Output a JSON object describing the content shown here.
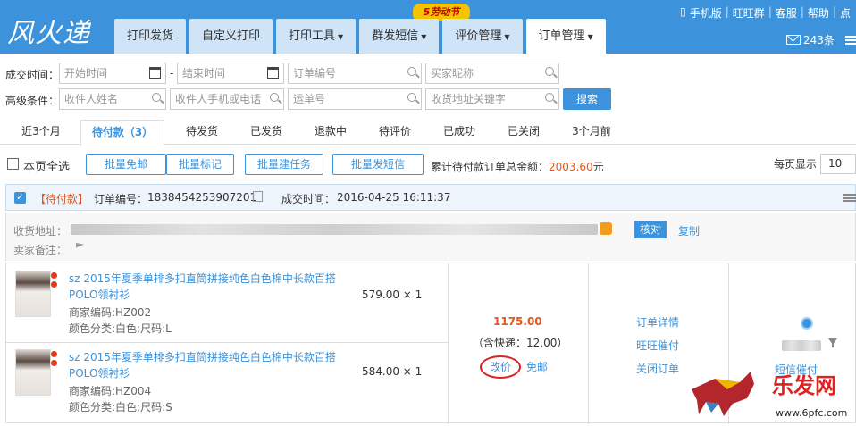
{
  "header": {
    "logo": "风火递",
    "nav": [
      {
        "label": "打印发货",
        "caret": false,
        "active": false
      },
      {
        "label": "自定义打印",
        "caret": false,
        "active": false
      },
      {
        "label": "打印工具",
        "caret": true,
        "active": false
      },
      {
        "label": "群发短信",
        "caret": true,
        "active": false
      },
      {
        "label": "评价管理",
        "caret": true,
        "active": false
      },
      {
        "label": "订单管理",
        "caret": true,
        "active": true
      }
    ],
    "promo": "5劳动节",
    "toplinks": [
      "手机版",
      "旺旺群",
      "客服",
      "帮助",
      "点"
    ],
    "mail_count": "243条"
  },
  "filters": {
    "row1_label": "成交时间：",
    "start_ph": "开始时间",
    "dash": "-",
    "end_ph": "结束时间",
    "order_no_ph": "订单编号",
    "buyer_ph": "买家昵称",
    "row2_label": "高级条件：",
    "receiver_name_ph": "收件人姓名",
    "receiver_phone_ph": "收件人手机或电话",
    "waybill_ph": "运单号",
    "address_ph": "收货地址关键字",
    "search": "搜索"
  },
  "tabs": [
    "近3个月",
    "待付款（3）",
    "待发货",
    "已发货",
    "退款中",
    "待评价",
    "已成功",
    "已关闭",
    "3个月前"
  ],
  "active_tab": 1,
  "toolbar": {
    "select_all": "本页全选",
    "buttons": [
      "批量免邮",
      "批量标记",
      "批量建任务",
      "批量发短信"
    ],
    "total_label": "累计待付款订单总金额：",
    "total_amount": "2003.60",
    "total_unit": "元",
    "per_page_label": "每页显示",
    "per_page_value": "10"
  },
  "order": {
    "status": "【待付款】",
    "order_no_label": "订单编号：",
    "order_no": "1838454253907201",
    "time_label": "成交时间：",
    "time": "2016-04-25 16:11:37",
    "address_label": "收货地址：",
    "seller_note_label": "卖家备注：",
    "verify": "核对",
    "copy": "复制",
    "items": [
      {
        "title": "sz 2015年夏季单排多扣直筒拼接纯色白色棉中长款百搭POLO领衬衫",
        "code": "商家编码:HZ002",
        "spec": "颜色分类:白色;尺码:L",
        "price": "579.00 × 1"
      },
      {
        "title": "sz 2015年夏季单排多扣直筒拼接纯色白色棉中长款百搭POLO领衬衫",
        "code": "商家编码:HZ004",
        "spec": "颜色分类:白色;尺码:S",
        "price": "584.00 × 1"
      }
    ],
    "amount": "1175.00",
    "shipping": "（含快递：12.00）",
    "change_price": "改价",
    "free_ship": "免邮",
    "ops": [
      "订单详情",
      "旺旺催付",
      "关闭订单"
    ],
    "sms_remind": "短信催付"
  },
  "watermark": {
    "brand": "乐发网",
    "url": "www.6pfc.com"
  }
}
